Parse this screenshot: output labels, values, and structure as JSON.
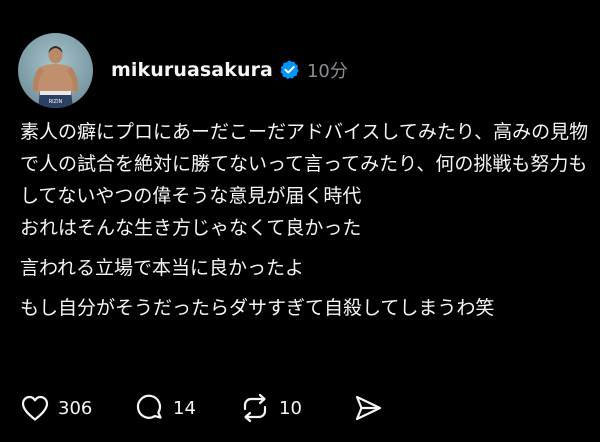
{
  "post": {
    "username": "mikuruasakura",
    "time": "10分",
    "verified_color": "#0095f6",
    "paragraphs": [
      "素人の癖にプロにあーだこーだアドバイスしてみたり、高みの見物で人の試合を絶対に勝てないって言ってみたり、何の挑戦も努力もしてないやつの偉そうな意見が届く時代",
      "おれはそんな生き方じゃなくて良かった",
      "言われる立場で本当に良かったよ",
      "もし自分がそうだったらダサすぎて自殺してしまうわ笑"
    ],
    "actions": {
      "likes": "306",
      "replies": "14",
      "reposts": "10"
    }
  },
  "icons": {
    "like": "heart-icon",
    "reply": "speech-bubble-icon",
    "repost": "repost-arrows-icon",
    "share": "send-icon",
    "verified": "verified-badge-icon"
  }
}
